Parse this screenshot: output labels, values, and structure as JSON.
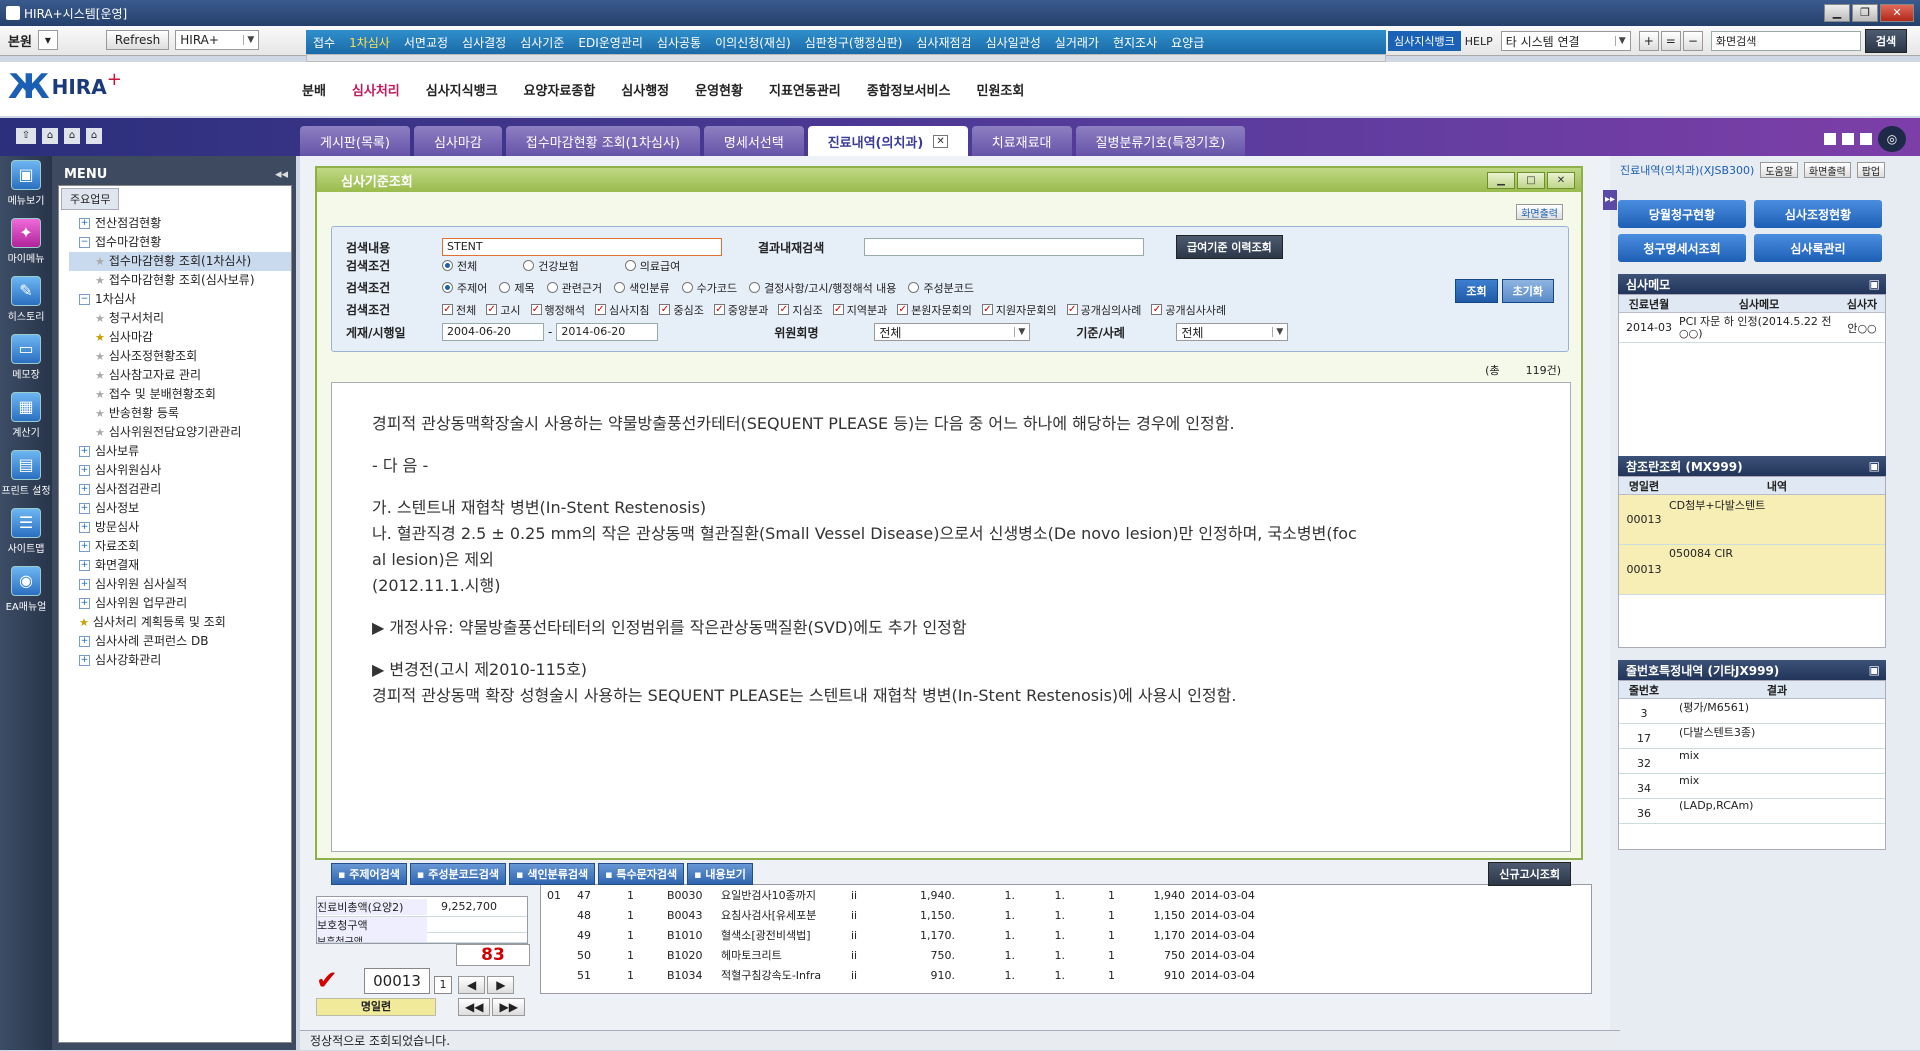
{
  "window": {
    "title": "HIRA+시스템[운영]"
  },
  "toolbar": {
    "org_select": "본원",
    "refresh_label": "Refresh",
    "app_select": "HIRA+",
    "menu1": [
      "접수",
      "1차심사",
      "서면교정",
      "심사결정",
      "심사기준",
      "EDI운영관리",
      "심사공통",
      "이의신청(재심)",
      "심판청구(행정심판)",
      "심사재점검",
      "심사일관성",
      "실거래가",
      "현지조사",
      "요양급"
    ],
    "menu1_active": 1,
    "knowledge_tag": "심사지식뱅크",
    "help_label": "HELP",
    "system_select": "타 시스템 연결",
    "screen_search_value": "화면검색",
    "search_btn": "검색"
  },
  "logo": {
    "text": "HIRA",
    "plus": "+"
  },
  "menu2": [
    "분배",
    "심사처리",
    "심사지식뱅크",
    "요양자료종합",
    "심사행정",
    "운영현황",
    "지표연동관리",
    "종합정보서비스",
    "민원조회"
  ],
  "menu2_active": 1,
  "tabs": [
    "게시판(목록)",
    "심사마감",
    "접수마감현황 조회(1차심사)",
    "명세서선택",
    "진료내역(의치과)",
    "치료재료대",
    "질병분류기호(특정기호)"
  ],
  "tabs_active": 4,
  "sidebar_icons": [
    "메뉴보기",
    "마이메뉴",
    "히스토리",
    "메모장",
    "계산기",
    "프린트 설정",
    "사이트맵",
    "EA매뉴얼"
  ],
  "menu": {
    "title": "MENU",
    "tab": "주요업무",
    "items": [
      {
        "label": "전산점검현황",
        "type": "plus",
        "level": 1
      },
      {
        "label": "접수마감현황",
        "type": "minus",
        "level": 1
      },
      {
        "label": "접수마감현황 조회(1차심사)",
        "type": "gstar",
        "level": 2,
        "selected": true
      },
      {
        "label": "접수마감현황 조회(심사보류)",
        "type": "gstar",
        "level": 2
      },
      {
        "label": "1차심사",
        "type": "minus",
        "level": 1
      },
      {
        "label": "청구서처리",
        "type": "gstar",
        "level": 2
      },
      {
        "label": "심사마감",
        "type": "star",
        "level": 2
      },
      {
        "label": "심사조정현황조회",
        "type": "gstar",
        "level": 2
      },
      {
        "label": "심사참고자료 관리",
        "type": "gstar",
        "level": 2
      },
      {
        "label": "접수 및 분배현황조회",
        "type": "gstar",
        "level": 2
      },
      {
        "label": "반송현황 등록",
        "type": "gstar",
        "level": 2
      },
      {
        "label": "심사위원전담요양기관관리",
        "type": "gstar",
        "level": 2
      },
      {
        "label": "심사보류",
        "type": "plus",
        "level": 1
      },
      {
        "label": "심사위원심사",
        "type": "plus",
        "level": 1
      },
      {
        "label": "심사점검관리",
        "type": "plus",
        "level": 1
      },
      {
        "label": "심사정보",
        "type": "plus",
        "level": 1
      },
      {
        "label": "방문심사",
        "type": "plus",
        "level": 1
      },
      {
        "label": "자료조회",
        "type": "plus",
        "level": 1
      },
      {
        "label": "화면결재",
        "type": "plus",
        "level": 1
      },
      {
        "label": "심사위원 심사실적",
        "type": "plus",
        "level": 1
      },
      {
        "label": "심사위원 업무관리",
        "type": "plus",
        "level": 1
      },
      {
        "label": "심사처리 계획등록 및 조회",
        "type": "star",
        "level": 1
      },
      {
        "label": "심사사례 콘퍼런스 DB",
        "type": "plus",
        "level": 1
      },
      {
        "label": "심사강화관리",
        "type": "plus",
        "level": 1
      }
    ]
  },
  "breadcrumb": "진료내역(의치과)(XJSB300)",
  "breadcrumb_buttons": [
    "도움말",
    "화면출력",
    "팝업"
  ],
  "dialog": {
    "title": "심사기준조회",
    "print_btn": "화면출력",
    "labels": {
      "keyword": "검색내용",
      "result_search": "결과내재검색",
      "cond1": "검색조건",
      "cond2": "검색조건",
      "cond3": "검색조건",
      "date": "게재/시행일",
      "committee": "위원회명",
      "standard": "기준/사례"
    },
    "keyword_value": "STENT",
    "history_btn": "급여기준 이력조회",
    "cond1_options": [
      "전체",
      "건강보험",
      "의료급여"
    ],
    "cond2_options": [
      "주제어",
      "제목",
      "관련근거",
      "색인분류",
      "수가코드",
      "결정사항/고시/행정해석 내용",
      "주성분코드"
    ],
    "cond3_options": [
      "전체",
      "고시",
      "행정해석",
      "심사지침",
      "중심조",
      "중앙분과",
      "지심조",
      "지역분과",
      "본원자문회의",
      "지원자문회의",
      "공개심의사례",
      "공개심사사례"
    ],
    "date_from": "2004-06-20",
    "date_sep": "-",
    "date_to": "2014-06-20",
    "committee_value": "전체",
    "standard_value": "전체",
    "query_btn": "조회",
    "reset_btn": "초기화",
    "total_label": "(총",
    "total_count": "119건)",
    "content": [
      "경피적 관상동맥확장술시 사용하는 약물방출풍선카테터(SEQUENT PLEASE 등)는 다음 중 어느 하나에 해당하는 경우에 인정함.",
      "",
      "- 다 음 -",
      "",
      "가. 스텐트내 재협착 병변(In-Stent Restenosis)",
      "나. 혈관직경 2.5 ± 0.25 mm의 작은 관상동맥 혈관질환(Small Vessel Disease)으로서 신생병소(De novo lesion)만 인정하며, 국소병변(foc",
      "al lesion)은 제외",
      "(2012.11.1.시행)",
      "",
      "▶ 개정사유: 약물방출풍선타테터의 인정범위를 작은관상동맥질환(SVD)에도 추가 인정함",
      "",
      "▶ 변경전(고시 제2010-115호)",
      "경피적 관상동맥 확장 성형술시 사용하는 SEQUENT PLEASE는 스텐트내 재협착 병변(In-Stent Restenosis)에 사용시 인정함."
    ],
    "footer_btns": [
      "주제어검색",
      "주성분코드검색",
      "색인분류검색",
      "특수문자검색",
      "내용보기"
    ],
    "new_notice_btn": "신규고시조회"
  },
  "right": {
    "buttons": [
      "당월청구현황",
      "심사조정현황",
      "청구명세서조회",
      "심사록관리"
    ],
    "memo": {
      "title": "심사메모",
      "headers": [
        "진료년월",
        "심사메모",
        "심사자"
      ],
      "rows": [
        [
          "2014-03",
          "PCI 자문 하 인정(2014.5.22 전○○)",
          "안○○"
        ]
      ]
    },
    "ref": {
      "title": "참조란조회 (MX999)",
      "headers": [
        "명일련",
        "내역"
      ],
      "rows": [
        [
          "00013",
          "CD첨부+다발스텐트"
        ],
        [
          "00013",
          "050084 CIR"
        ]
      ]
    },
    "special": {
      "title": "줄번호특정내역 (기타JX999)",
      "headers": [
        "줄번호",
        "결과"
      ],
      "rows": [
        [
          "3",
          "(평가/M6561)"
        ],
        [
          "17",
          "(다발스텐트3종)"
        ],
        [
          "32",
          "mix"
        ],
        [
          "34",
          "mix"
        ],
        [
          "36",
          "(LADp,RCAm)"
        ]
      ]
    }
  },
  "lower": {
    "left_rows": [
      [
        "진료비총액(요양2)",
        "9,252,700"
      ],
      [
        "보호청구액",
        ""
      ],
      [
        "보훈청구액",
        ""
      ]
    ],
    "count_red": "83",
    "serial": "00013",
    "page": "1",
    "serial_label": "명일련",
    "rows": [
      [
        "01",
        "47",
        "1",
        "B0030",
        "요일반검사10종까지",
        "ii",
        "1,940.",
        "1.",
        "1.",
        "1",
        "1,940",
        "2014-03-04"
      ],
      [
        "",
        "48",
        "1",
        "B0043",
        "요침사검사[유세포분",
        "ii",
        "1,150.",
        "1.",
        "1.",
        "1",
        "1,150",
        "2014-03-04"
      ],
      [
        "",
        "49",
        "1",
        "B1010",
        "혈색소[광전비색법]",
        "ii",
        "1,170.",
        "1.",
        "1.",
        "1",
        "1,170",
        "2014-03-04"
      ],
      [
        "",
        "50",
        "1",
        "B1020",
        "헤마토크리트",
        "ii",
        "750.",
        "1.",
        "1.",
        "1",
        "750",
        "2014-03-04"
      ],
      [
        "",
        "51",
        "1",
        "B1034",
        "적혈구침강속도-Infra",
        "ii",
        "910.",
        "1.",
        "1.",
        "1",
        "910",
        "2014-03-04"
      ]
    ]
  },
  "status": "정상적으로 조회되었습니다."
}
